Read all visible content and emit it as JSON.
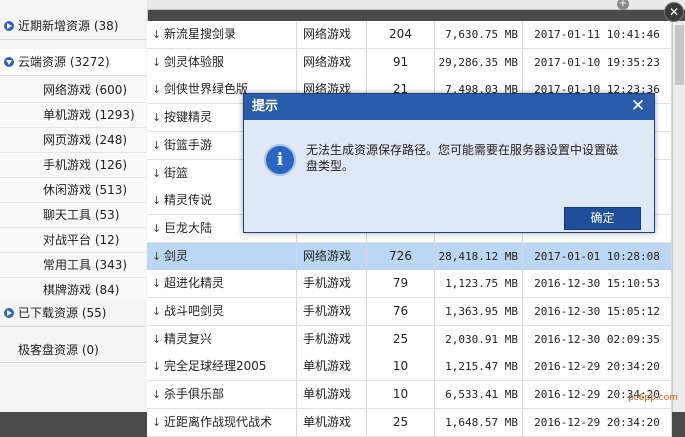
{
  "sidebar": {
    "groups": [
      {
        "label": "近期新增资源 (38)"
      },
      {
        "label": "云端资源 (3272)"
      },
      {
        "label": "已下载资源 (55)"
      }
    ],
    "items": [
      {
        "label": "网络游戏 (600)"
      },
      {
        "label": "单机游戏 (1293)"
      },
      {
        "label": "网页游戏 (248)"
      },
      {
        "label": "手机游戏 (126)"
      },
      {
        "label": "休闲游戏 (513)"
      },
      {
        "label": "聊天工具 (53)"
      },
      {
        "label": "对战平台 (12)"
      },
      {
        "label": "常用工具 (343)"
      },
      {
        "label": "棋牌游戏 (84)"
      }
    ],
    "plain": "极客盘资源 (0)"
  },
  "topbar": {
    "add_icon": "plus-icon",
    "close_icon": "close-icon"
  },
  "table": {
    "rows": [
      {
        "name": "新流星搜剑录",
        "type": "网络游戏",
        "count": "204",
        "size": "7,630.75 MB",
        "date": "2017-01-11 10:41:46"
      },
      {
        "name": "剑灵体验服",
        "type": "网络游戏",
        "count": "91",
        "size": "29,286.35 MB",
        "date": "2017-01-10 19:35:23"
      },
      {
        "name": "剑侠世界绿色版",
        "type": "网络游戏",
        "count": "21",
        "size": "7,498.03 MB",
        "date": "2017-01-10 12:23:36"
      },
      {
        "name": "按键精灵",
        "type": "",
        "count": "",
        "size": "",
        "date": ""
      },
      {
        "name": "街篮手游",
        "type": "",
        "count": "",
        "size": "",
        "date": ""
      },
      {
        "name": "街篮",
        "type": "",
        "count": "",
        "size": "",
        "date": ""
      },
      {
        "name": "精灵传说",
        "type": "",
        "count": "",
        "size": "",
        "date": ""
      },
      {
        "name": "巨龙大陆",
        "type": "",
        "count": "",
        "size": "",
        "date": ""
      },
      {
        "name": "剑灵",
        "type": "网络游戏",
        "count": "726",
        "size": "28,418.12 MB",
        "date": "2017-01-01 10:28:08"
      },
      {
        "name": "超进化精灵",
        "type": "手机游戏",
        "count": "79",
        "size": "1,123.75 MB",
        "date": "2016-12-30 15:10:53"
      },
      {
        "name": "战斗吧剑灵",
        "type": "手机游戏",
        "count": "76",
        "size": "1,363.95 MB",
        "date": "2016-12-30 15:05:12"
      },
      {
        "name": "精灵复兴",
        "type": "手机游戏",
        "count": "25",
        "size": "2,030.91 MB",
        "date": "2016-12-30 02:09:35"
      },
      {
        "name": "完全足球经理2005",
        "type": "单机游戏",
        "count": "10",
        "size": "1,215.47 MB",
        "date": "2016-12-29 20:34:20"
      },
      {
        "name": "杀手俱乐部",
        "type": "单机游戏",
        "count": "10",
        "size": "6,533.41 MB",
        "date": "2016-12-29 20:34:20"
      },
      {
        "name": "近距离作战现代战术",
        "type": "单机游戏",
        "count": "25",
        "size": "1,648.57 MB",
        "date": "2016-12-29 20:34:20"
      }
    ],
    "selected_index": 8
  },
  "dialog": {
    "title": "提示",
    "message": "无法生成资源保存路径。您可能需要在服务器设置中设置磁盘类型。",
    "ok_label": "确定",
    "icon": "info-icon",
    "close_icon": "close-icon"
  },
  "watermark": "pc6pp.com"
}
